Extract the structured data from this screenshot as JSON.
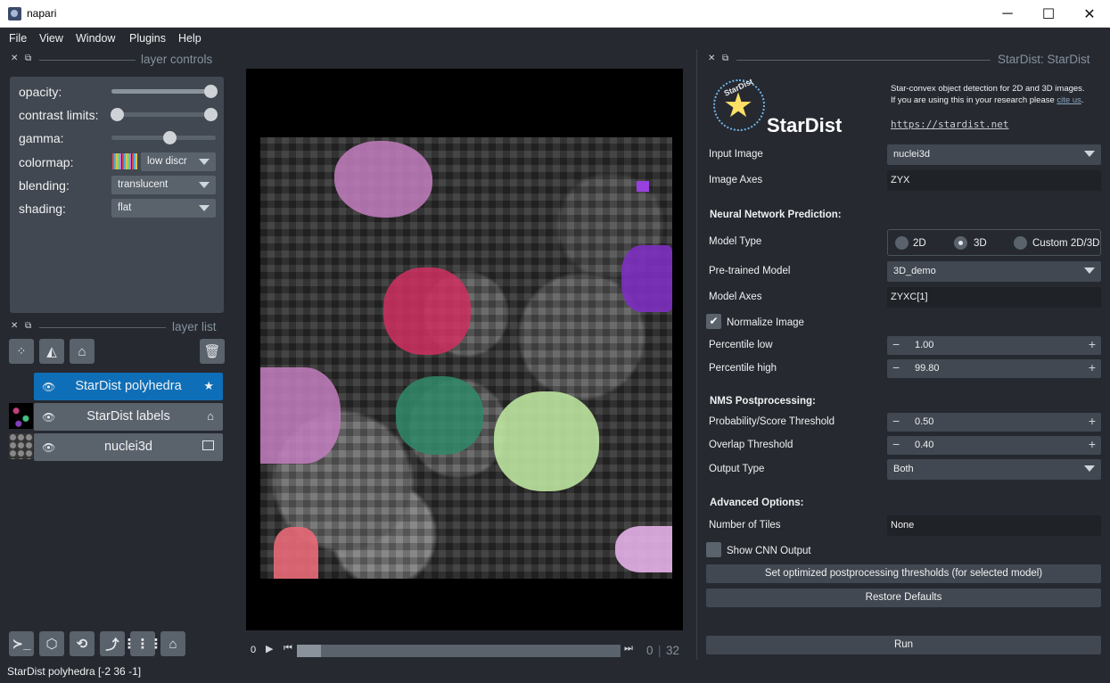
{
  "window": {
    "title": "napari",
    "minimize": "─",
    "maximize": "☐",
    "close": "✕"
  },
  "menu": [
    "File",
    "View",
    "Window",
    "Plugins",
    "Help"
  ],
  "layer_controls": {
    "header": "layer controls",
    "opacity_label": "opacity:",
    "opacity_value": 1.0,
    "contrast_label": "contrast limits:",
    "contrast_range": [
      0.0,
      1.0
    ],
    "gamma_label": "gamma:",
    "gamma_value": 0.5,
    "colormap_label": "colormap:",
    "colormap_value": "low discr",
    "blending_label": "blending:",
    "blending_value": "translucent",
    "shading_label": "shading:",
    "shading_value": "flat"
  },
  "layer_list": {
    "header": "layer list",
    "layers": [
      {
        "name": "StarDist polyhedra",
        "selected": true,
        "type_icon": "star-icon"
      },
      {
        "name": "StarDist labels",
        "selected": false,
        "type_icon": "tag-icon"
      },
      {
        "name": "nuclei3d",
        "selected": false,
        "type_icon": "image-icon"
      }
    ]
  },
  "dims": {
    "play": "▶",
    "current": "0",
    "slider_start": "0",
    "max": "32"
  },
  "statusbar": "StarDist polyhedra [-2 36 -1]",
  "stardist": {
    "header": "StarDist: StarDist",
    "logo_text": "StarDist",
    "logo_arc": "StarDist",
    "desc_line1": "Star-convex object detection for 2D and 3D images.",
    "desc_line2": "If you are using this in your research please",
    "cite_link": "cite us",
    "cite_period": ".",
    "url": "https://stardist.net",
    "input_image_label": "Input Image",
    "input_image_value": "nuclei3d",
    "image_axes_label": "Image Axes",
    "image_axes_value": "ZYX",
    "nn_section": "Neural Network Prediction:",
    "model_type_label": "Model Type",
    "model_type_options": [
      "2D",
      "3D",
      "Custom 2D/3D"
    ],
    "model_type_selected": "3D",
    "pretrained_label": "Pre-trained Model",
    "pretrained_value": "3D_demo",
    "model_axes_label": "Model Axes",
    "model_axes_value": "ZYXC[1]",
    "normalize_label": "Normalize Image",
    "normalize_checked": true,
    "perc_low_label": "Percentile low",
    "perc_low_value": "1.00",
    "perc_high_label": "Percentile high",
    "perc_high_value": "99.80",
    "nms_section": "NMS Postprocessing:",
    "prob_label": "Probability/Score Threshold",
    "prob_value": "0.50",
    "overlap_label": "Overlap Threshold",
    "overlap_value": "0.40",
    "output_type_label": "Output Type",
    "output_type_value": "Both",
    "adv_section": "Advanced Options:",
    "tiles_label": "Number of Tiles",
    "tiles_value": "None",
    "show_cnn_label": "Show CNN Output",
    "show_cnn_checked": false,
    "set_thresholds_btn": "Set optimized postprocessing thresholds (for selected model)",
    "restore_btn": "Restore Defaults",
    "run_btn": "Run"
  },
  "colors": {
    "bg": "#262930",
    "panel": "#414851",
    "selected": "#0e6fb8",
    "accent_link": "#8aa6c2"
  },
  "blob_colors": [
    "#c47ec0",
    "#7d2fc0",
    "#d03060",
    "#2f8a6a",
    "#bfe8a0",
    "#d880d8",
    "#e96a78",
    "#e4b0e8",
    "#9a40e0"
  ]
}
